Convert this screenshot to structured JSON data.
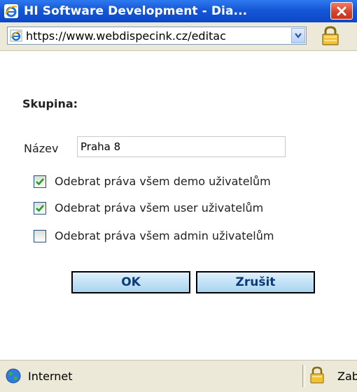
{
  "window": {
    "title": "HI Software Development - Dia...",
    "close_icon": "close-icon"
  },
  "address_bar": {
    "url": "https://www.webdispecink.cz/editac"
  },
  "form": {
    "group_title": "Skupina:",
    "name_label": "Název",
    "name_value": "Praha 8",
    "checkboxes": [
      {
        "label": "Odebrat práva všem demo uživatelům",
        "checked": true
      },
      {
        "label": "Odebrat práva všem user uživatelům",
        "checked": true
      },
      {
        "label": "Odebrat práva všem admin uživatelům",
        "checked": false
      }
    ],
    "ok_label": "OK",
    "cancel_label": "Zrušit"
  },
  "status_bar": {
    "zone": "Internet",
    "security_text": "Zab"
  },
  "colors": {
    "titlebar": "#1457d6",
    "button_bg": "#a8d4f0",
    "checkmark": "#21a121"
  }
}
